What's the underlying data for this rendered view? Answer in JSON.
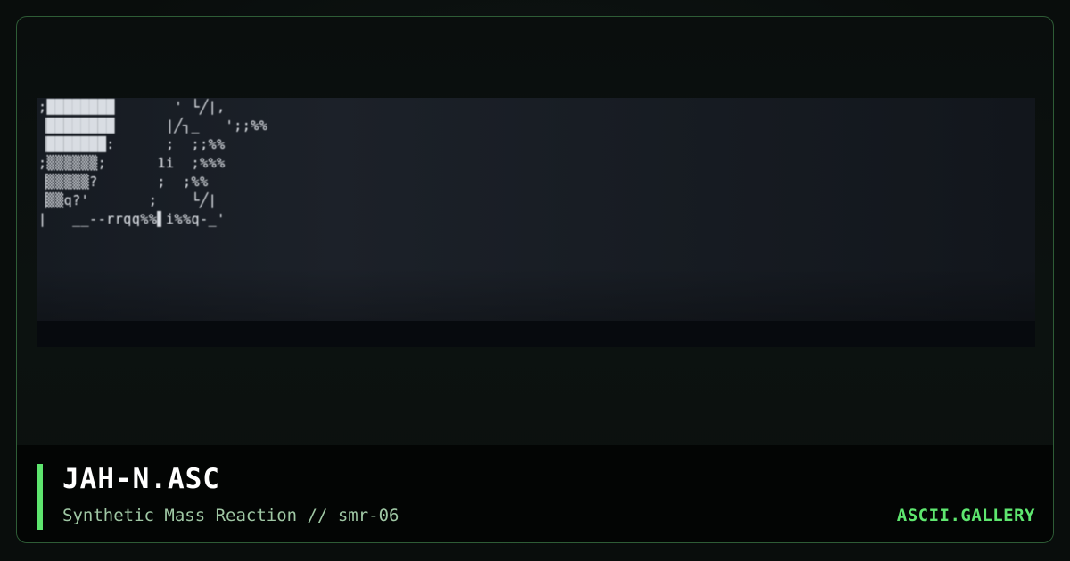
{
  "artwork": {
    "ascii_lines": [
      ";████████       ' └╱|,",
      "▕████████      |╱┐_   ';;%%",
      "▕███████:      ;  ;;%%",
      ";▒▒▒▒▒▒;      1i  ;%%%",
      "▕▒▒▒▒▒?       ;  ;%%",
      "▕▒▒q?'       ;    └╱|",
      "|   __--rrqq%%▌i%%q-_'"
    ]
  },
  "footer": {
    "title": "JAH-N.ASC",
    "subtitle": "Synthetic Mass Reaction // smr-06",
    "brand": "ASCII.GALLERY"
  },
  "colors": {
    "accent": "#5ee66f",
    "frame_border": "#2e5c36",
    "subtitle_text": "#9fc7a4"
  }
}
